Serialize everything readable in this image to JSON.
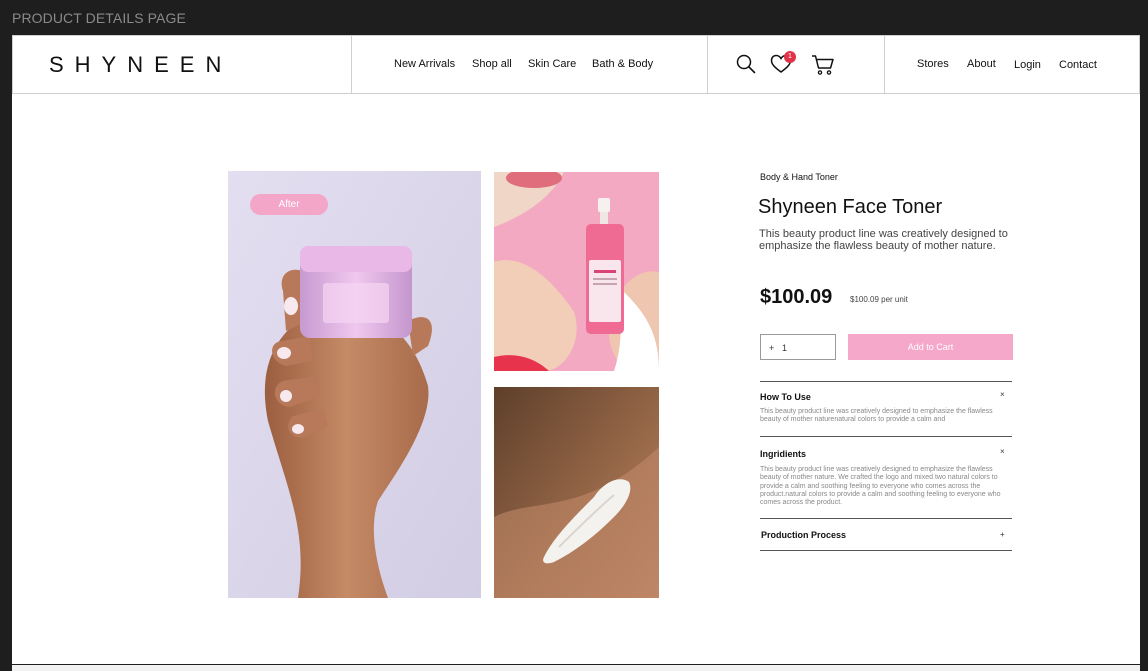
{
  "frame_label": "PRODUCT DETAILS PAGE",
  "header": {
    "logo": "SHYNEEN",
    "nav": [
      "New Arrivals",
      "Shop all",
      "Skin Care",
      "Bath & Body"
    ],
    "icons": [
      "search-icon",
      "heart-icon",
      "cart-icon"
    ],
    "wishlist_count": "1",
    "right_nav": [
      "Stores",
      "About",
      "Login",
      "Contact"
    ]
  },
  "gallery": {
    "badge": "After"
  },
  "product": {
    "category": "Body & Hand Toner",
    "title": "Shyneen Face Toner",
    "description": "This beauty product line was creatively designed to emphasize the flawless beauty of mother nature.",
    "price": "$100.09",
    "unit_price": "$100.09 per unit",
    "quantity_symbol": "+",
    "quantity": "1",
    "add_to_cart": "Add to Cart"
  },
  "accordion": [
    {
      "title": "How To Use",
      "toggle": "×",
      "body": "This beauty product line was creatively designed to emphasize the flawless beauty of mother naturenatural colors to provide a calm and"
    },
    {
      "title": "Ingridients",
      "toggle": "×",
      "body": "This beauty product line was creatively designed to emphasize the flawless beauty of mother nature. We crafted the logo and mixed two natural colors to provide a calm and soothing feeling to everyone who comes across the product.natural colors to provide a calm and soothing feeling to everyone who comes across the product."
    },
    {
      "title": "Production Process",
      "toggle": "+",
      "body": ""
    }
  ],
  "colors": {
    "accent_pink": "#f5a8c9",
    "badge_red": "#e0334a",
    "frame_bg": "#1e1e1e"
  }
}
